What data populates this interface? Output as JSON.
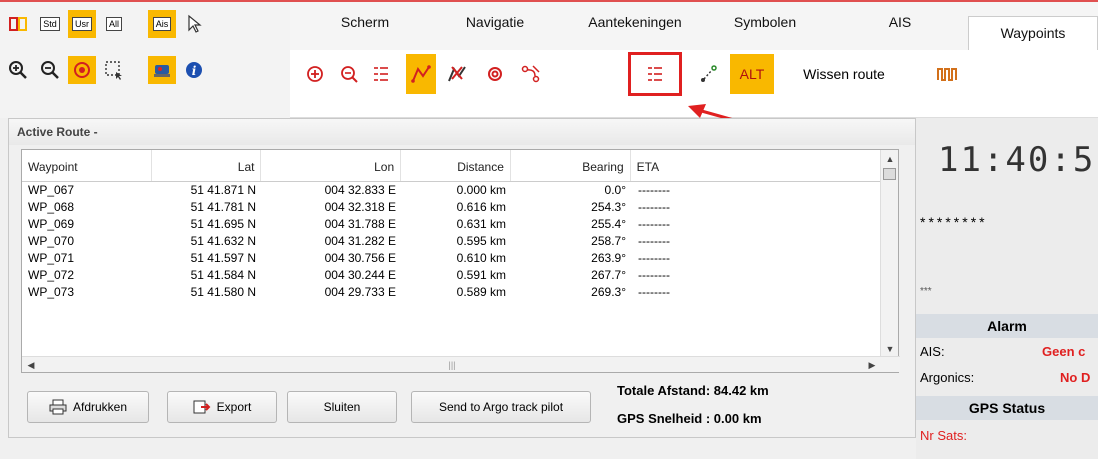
{
  "toolbar_left": {
    "std": "Std",
    "usr": "Usr",
    "all": "All",
    "ais": "Ais"
  },
  "tabs": [
    {
      "label": "Scherm"
    },
    {
      "label": "Navigatie"
    },
    {
      "label": "Aantekeningen"
    },
    {
      "label": "Symbolen"
    },
    {
      "label": "AIS"
    },
    {
      "label": "Waypoints"
    }
  ],
  "subtools": {
    "alt_label": "ALT",
    "clear_route_label": "Wissen route"
  },
  "route_panel": {
    "title": "Active Route -",
    "columns": [
      "Waypoint",
      "Lat",
      "Lon",
      "Distance",
      "Bearing",
      "ETA"
    ],
    "rows": [
      {
        "wp": "WP_067",
        "lat": "51 41.871 N",
        "lon": "004 32.833 E",
        "dist": "0.000 km",
        "bearing": "0.0°",
        "eta": "--------"
      },
      {
        "wp": "WP_068",
        "lat": "51 41.781 N",
        "lon": "004 32.318 E",
        "dist": "0.616 km",
        "bearing": "254.3°",
        "eta": "--------"
      },
      {
        "wp": "WP_069",
        "lat": "51 41.695 N",
        "lon": "004 31.788 E",
        "dist": "0.631 km",
        "bearing": "255.4°",
        "eta": "--------"
      },
      {
        "wp": "WP_070",
        "lat": "51 41.632 N",
        "lon": "004 31.282 E",
        "dist": "0.595 km",
        "bearing": "258.7°",
        "eta": "--------"
      },
      {
        "wp": "WP_071",
        "lat": "51 41.597 N",
        "lon": "004 30.756 E",
        "dist": "0.610 km",
        "bearing": "263.9°",
        "eta": "--------"
      },
      {
        "wp": "WP_072",
        "lat": "51 41.584 N",
        "lon": "004 30.244 E",
        "dist": "0.591 km",
        "bearing": "267.7°",
        "eta": "--------"
      },
      {
        "wp": "WP_073",
        "lat": "51 41.580 N",
        "lon": "004 29.733 E",
        "dist": "0.589 km",
        "bearing": "269.3°",
        "eta": "--------"
      }
    ],
    "buttons": {
      "print": "Afdrukken",
      "export": "Export",
      "close": "Sluiten",
      "send": "Send to Argo track pilot"
    },
    "totals": {
      "distance": "Totale Afstand: 84.42 km",
      "speed": "GPS Snelheid : 0.00 km"
    }
  },
  "right_panel": {
    "clock": "11:40:5",
    "stars": "********",
    "dots": "***",
    "alarm_title": "Alarm",
    "ais_label": "AIS:",
    "ais_value": "Geen c",
    "argonics_label": "Argonics:",
    "argonics_value": "No D",
    "gps_title": "GPS Status",
    "sats_label": "Nr Sats:"
  },
  "colors": {
    "accent_yellow": "#f9b800",
    "highlight_red": "#e02020",
    "icon_red": "#d22020"
  }
}
